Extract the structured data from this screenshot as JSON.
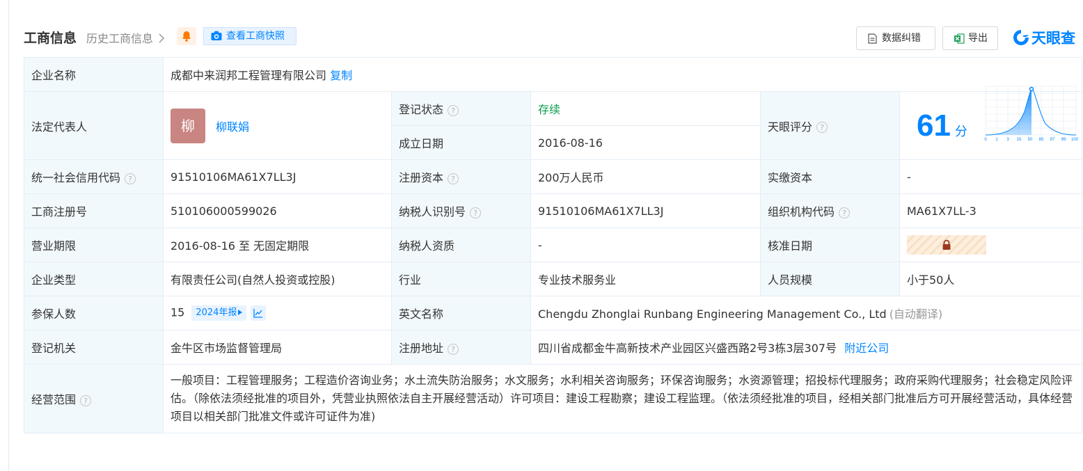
{
  "header": {
    "title": "工商信息",
    "history_link": "历史工商信息",
    "snapshot_button": "查看工商快照",
    "fix_button": "数据纠错",
    "export_button": "导出",
    "logo_text": "天眼查"
  },
  "colors": {
    "accent": "#0084ff",
    "label_background": "#f2f9fc",
    "status_green": "#0a9e4d",
    "avatar": "#c98582"
  },
  "icons": [
    "bell-icon",
    "camera-icon",
    "document-icon",
    "excel-icon",
    "tianyancha-logo-icon",
    "question-icon",
    "lock-icon",
    "trend-chart-icon"
  ],
  "company": {
    "name_label": "企业名称",
    "name": "成都中来润邦工程管理有限公司",
    "copy": "复制",
    "legal_rep_label": "法定代表人",
    "legal_rep_avatar": "柳",
    "legal_rep": "柳联娟",
    "status_label": "登记状态",
    "status": "存续",
    "founded_label": "成立日期",
    "founded": "2016-08-16",
    "score_label": "天眼评分",
    "score": "61",
    "score_unit": "分",
    "credit_code_label": "统一社会信用代码",
    "credit_code": "91510106MA61X7LL3J",
    "reg_capital_label": "注册资本",
    "reg_capital": "200万人民币",
    "paid_capital_label": "实缴资本",
    "paid_capital": "-",
    "reg_no_label": "工商注册号",
    "reg_no": "510106000599026",
    "taxpayer_id_label": "纳税人识别号",
    "taxpayer_id": "91510106MA61X7LL3J",
    "org_code_label": "组织机构代码",
    "org_code": "MA61X7LL-3",
    "term_label": "营业期限",
    "term": "2016-08-16 至 无固定期限",
    "taxpayer_qual_label": "纳税人资质",
    "taxpayer_qual": "-",
    "approval_date_label": "核准日期",
    "type_label": "企业类型",
    "type": "有限责任公司(自然人投资或控股)",
    "industry_label": "行业",
    "industry": "专业技术服务业",
    "staff_size_label": "人员规模",
    "staff_size": "小于50人",
    "insured_label": "参保人数",
    "insured": "15",
    "annual_report": "2024年报",
    "english_name_label": "英文名称",
    "english_name": "Chengdu Zhonglai Runbang Engineering Management Co., Ltd",
    "auto_translate": "(自动翻译)",
    "authority_label": "登记机关",
    "authority": "金牛区市场监督管理局",
    "address_label": "注册地址",
    "address": "四川省成都金牛高新技术产业园区兴盛西路2号3栋3层307号",
    "nearby": "附近公司",
    "scope_label": "经营范围",
    "scope": "一般项目：工程管理服务；工程造价咨询业务；水土流失防治服务；水文服务；水利相关咨询服务；环保咨询服务；水资源管理；招投标代理服务；政府采购代理服务；社会稳定风险评估。（除依法须经批准的项目外，凭营业执照依法自主开展经营活动）许可项目：建设工程勘察；建设工程监理。（依法须经批准的项目，经相关部门批准后方可开展经营活动，具体经营项目以相关部门批准文件或许可证件为准)"
  },
  "score_chart": {
    "type": "area",
    "x_ticks": [
      "0",
      "1",
      "3",
      "15",
      "50",
      "85",
      "97",
      "99",
      "100"
    ],
    "marker": 61
  }
}
